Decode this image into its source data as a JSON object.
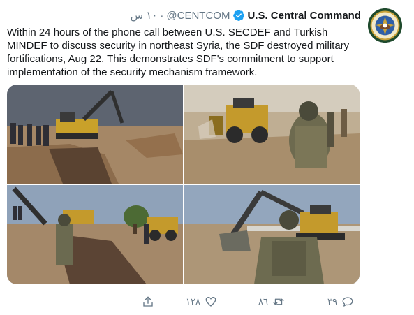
{
  "tweet": {
    "name": "U.S. Central Command",
    "handle": "@CENTCOM",
    "time": "١٠ س",
    "separator": "·",
    "text": "Within 24 hours of the phone call between U.S. SECDEF and Turkish MINDEF to discuss security in northeast Syria, the SDF destroyed military fortifications, Aug 22. This demonstrates SDF's commitment to support implementation of the security mechanism framework.",
    "avatar_icon": "centcom-seal-icon",
    "verified_icon": "verified-badge-icon",
    "photos": [
      {
        "icon": "photo-excavator-trench"
      },
      {
        "icon": "photo-bulldozer-soldier"
      },
      {
        "icon": "photo-excavator-trench-soldier"
      },
      {
        "icon": "photo-excavator-soldier-back"
      }
    ]
  },
  "actions": {
    "reply_count": "٣٩",
    "retweet_count": "٨٦",
    "like_count": "١٢٨",
    "reply_icon": "reply-icon",
    "retweet_icon": "retweet-icon",
    "like_icon": "heart-icon",
    "share_icon": "share-icon"
  },
  "colors": {
    "text": "#14171a",
    "muted": "#657786",
    "verified": "#1da1f2"
  }
}
